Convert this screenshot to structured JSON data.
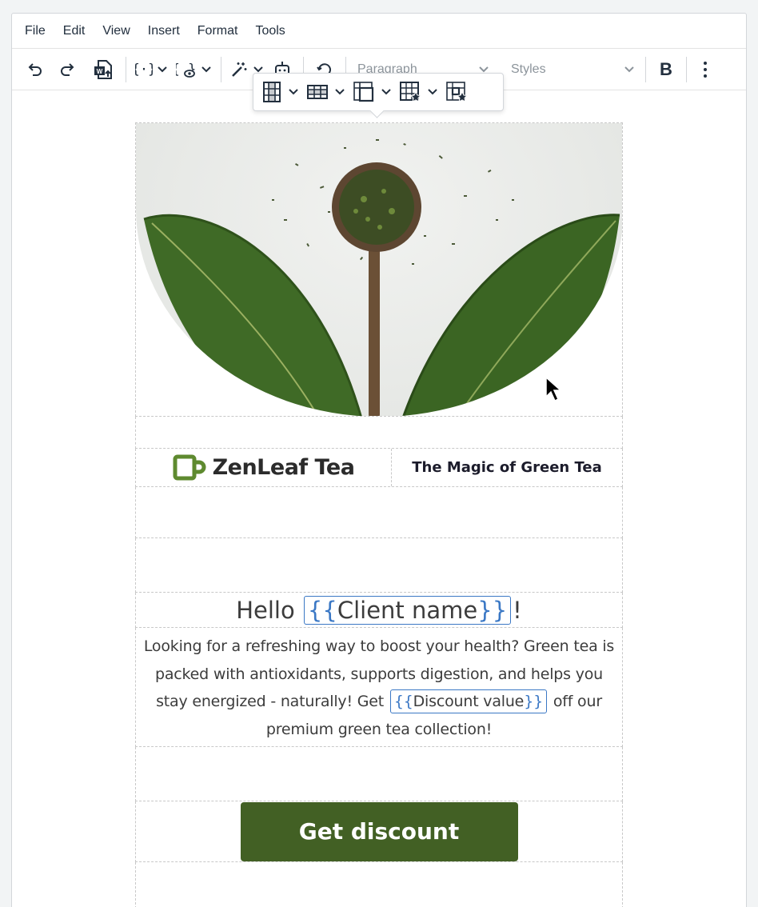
{
  "menubar": {
    "items": [
      "File",
      "Edit",
      "View",
      "Insert",
      "Format",
      "Tools"
    ]
  },
  "toolbar": {
    "buttons": [
      "undo-icon",
      "redo-icon",
      "import-word-icon",
      "merge-tags-icon",
      "preview-merge-icon",
      "ai-wand-icon",
      "ai-assistant-icon",
      "revision-icon",
      "bold-icon",
      "more-icon"
    ],
    "block_format": "Paragraph",
    "styles": "Styles",
    "bold_label": "B"
  },
  "table_toolbar": {
    "buttons": [
      "table-column-icon",
      "table-row-icon",
      "table-cell-icon",
      "table-properties-icon",
      "cell-properties-icon"
    ]
  },
  "email": {
    "brand_name": "ZenLeaf Tea",
    "tagline": "The Magic of Green Tea",
    "greeting_prefix": "Hello",
    "greeting_token": "Client name",
    "greeting_suffix": "!",
    "body_before": "Looking for a refreshing way to boost your health? Green tea is packed with antioxidants, supports digestion, and helps you stay energized - naturally! Get",
    "body_token": "Discount value",
    "body_after": "off our premium green tea collection!",
    "cta_label": "Get discount"
  },
  "colors": {
    "brand_green": "#426024",
    "logo_green": "#5e8a2f",
    "merge_tag_blue": "#3b78c5"
  }
}
